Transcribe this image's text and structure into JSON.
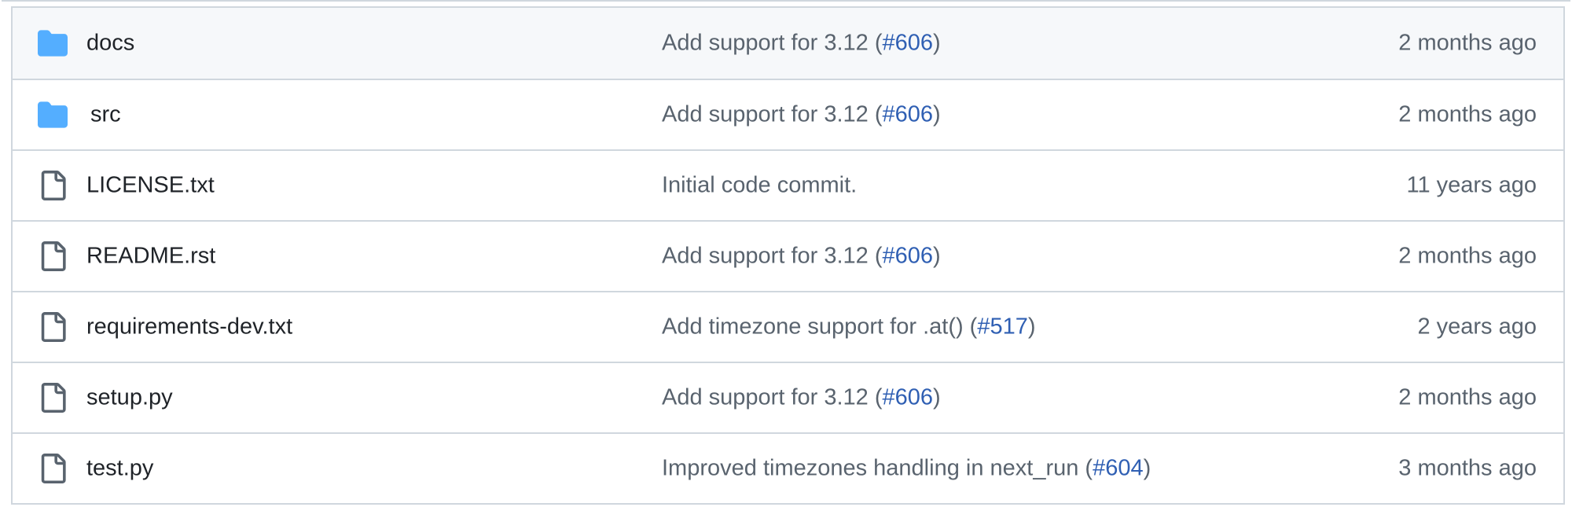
{
  "colors": {
    "folder": "#54aeff",
    "file_outline": "#59636e",
    "link": "#2f5fb3",
    "border": "#d0d7de",
    "hover_row_bg": "#f6f8fa"
  },
  "rows": [
    {
      "type": "folder",
      "icon": "folder-icon",
      "name": "docs",
      "msg_prefix": "Add support for 3.12 (",
      "pr": "#606",
      "msg_suffix": ")",
      "age": "2 months ago"
    },
    {
      "type": "folder",
      "icon": "folder-icon",
      "name": "src",
      "msg_prefix": "Add support for 3.12 (",
      "pr": "#606",
      "msg_suffix": ")",
      "age": "2 months ago"
    },
    {
      "type": "file",
      "icon": "file-icon",
      "name": "LICENSE.txt",
      "msg_prefix": "Initial code commit.",
      "pr": "",
      "msg_suffix": "",
      "age": "11 years ago"
    },
    {
      "type": "file",
      "icon": "file-icon",
      "name": "README.rst",
      "msg_prefix": "Add support for 3.12 (",
      "pr": "#606",
      "msg_suffix": ")",
      "age": "2 months ago"
    },
    {
      "type": "file",
      "icon": "file-icon",
      "name": "requirements-dev.txt",
      "msg_prefix": "Add timezone support for .at() (",
      "pr": "#517",
      "msg_suffix": ")",
      "age": "2 years ago"
    },
    {
      "type": "file",
      "icon": "file-icon",
      "name": "setup.py",
      "msg_prefix": "Add support for 3.12 (",
      "pr": "#606",
      "msg_suffix": ")",
      "age": "2 months ago"
    },
    {
      "type": "file",
      "icon": "file-icon",
      "name": "test.py",
      "msg_prefix": "Improved timezones handling in next_run (",
      "pr": "#604",
      "msg_suffix": ")",
      "age": "3 months ago"
    }
  ]
}
